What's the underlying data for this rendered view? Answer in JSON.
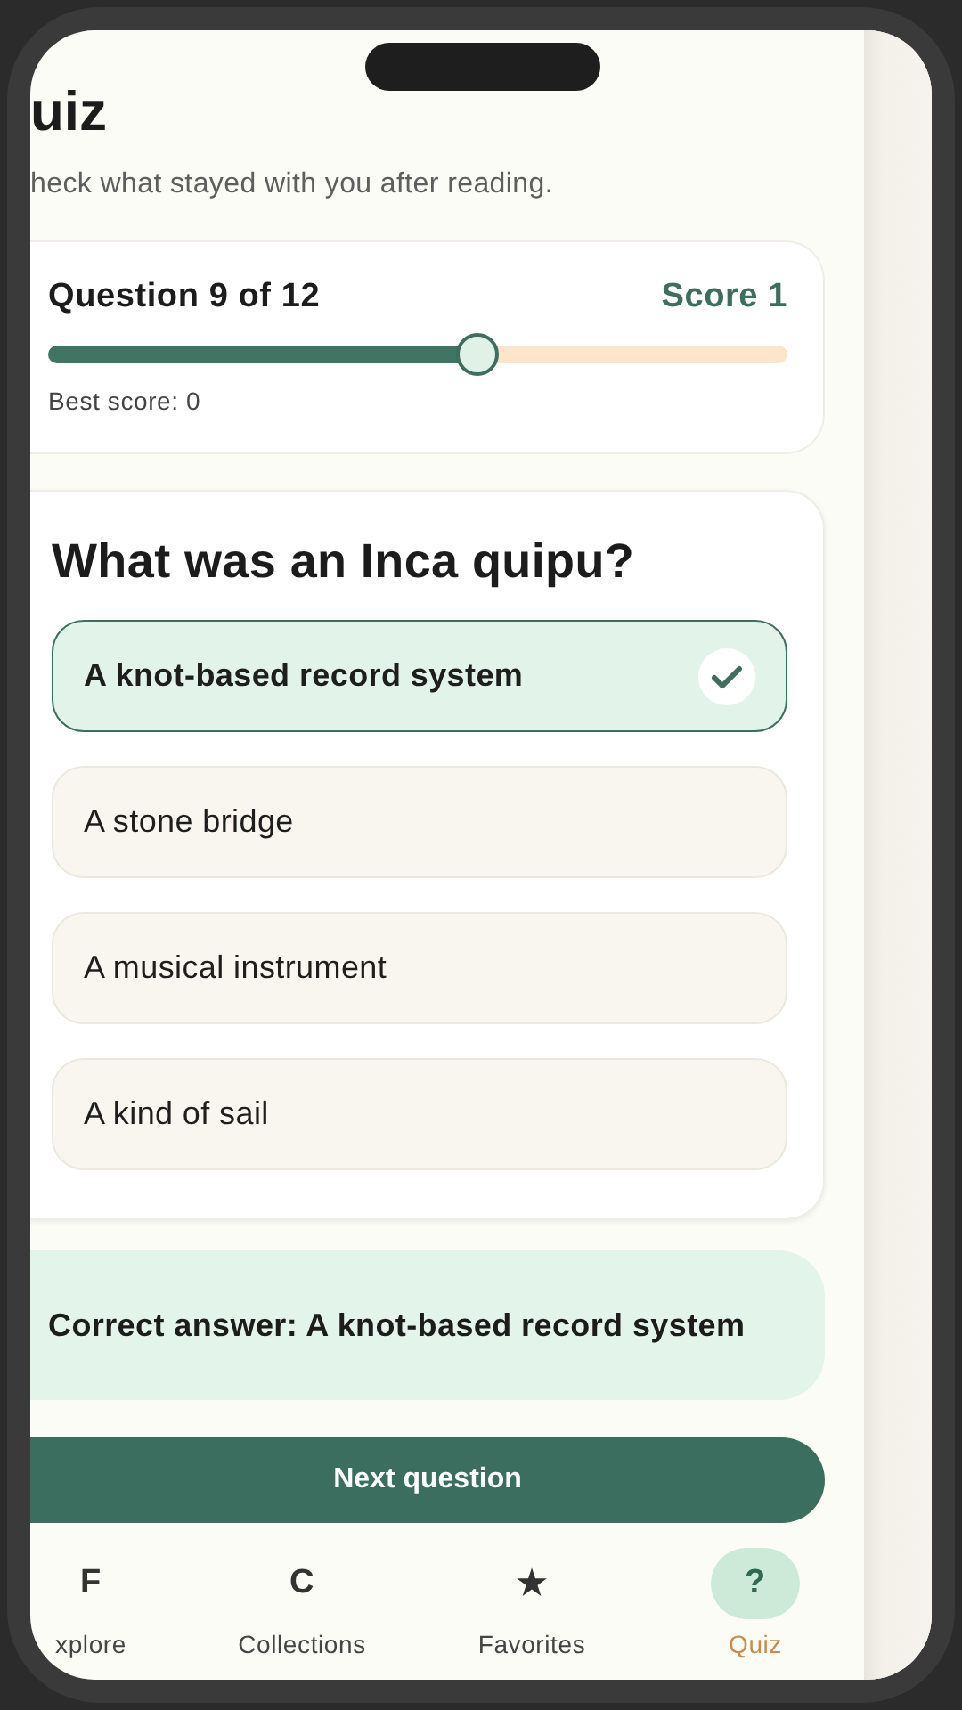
{
  "header": {
    "title": "uiz",
    "subtitle": "heck what stayed with you after reading."
  },
  "progress": {
    "question_label": "Question 9 of 12",
    "score": "Score 1",
    "level": 0.58,
    "best_score": "Best score: 0"
  },
  "question": {
    "text": "What was an Inca quipu?",
    "options": [
      {
        "label": "A knot-based record system",
        "selected": true
      },
      {
        "label": "A stone bridge",
        "selected": false
      },
      {
        "label": "A musical instrument",
        "selected": false
      },
      {
        "label": "A kind of sail",
        "selected": false
      }
    ]
  },
  "feedback": "Correct answer: A knot-based record system",
  "next_button": "Next question",
  "nav": [
    {
      "icon": "F",
      "label": "xplore",
      "selected": false
    },
    {
      "icon": "C",
      "label": "Collections",
      "selected": false
    },
    {
      "icon": "★",
      "label": "Favorites",
      "selected": false
    },
    {
      "icon": "?",
      "label": "Quiz",
      "selected": true
    }
  ]
}
